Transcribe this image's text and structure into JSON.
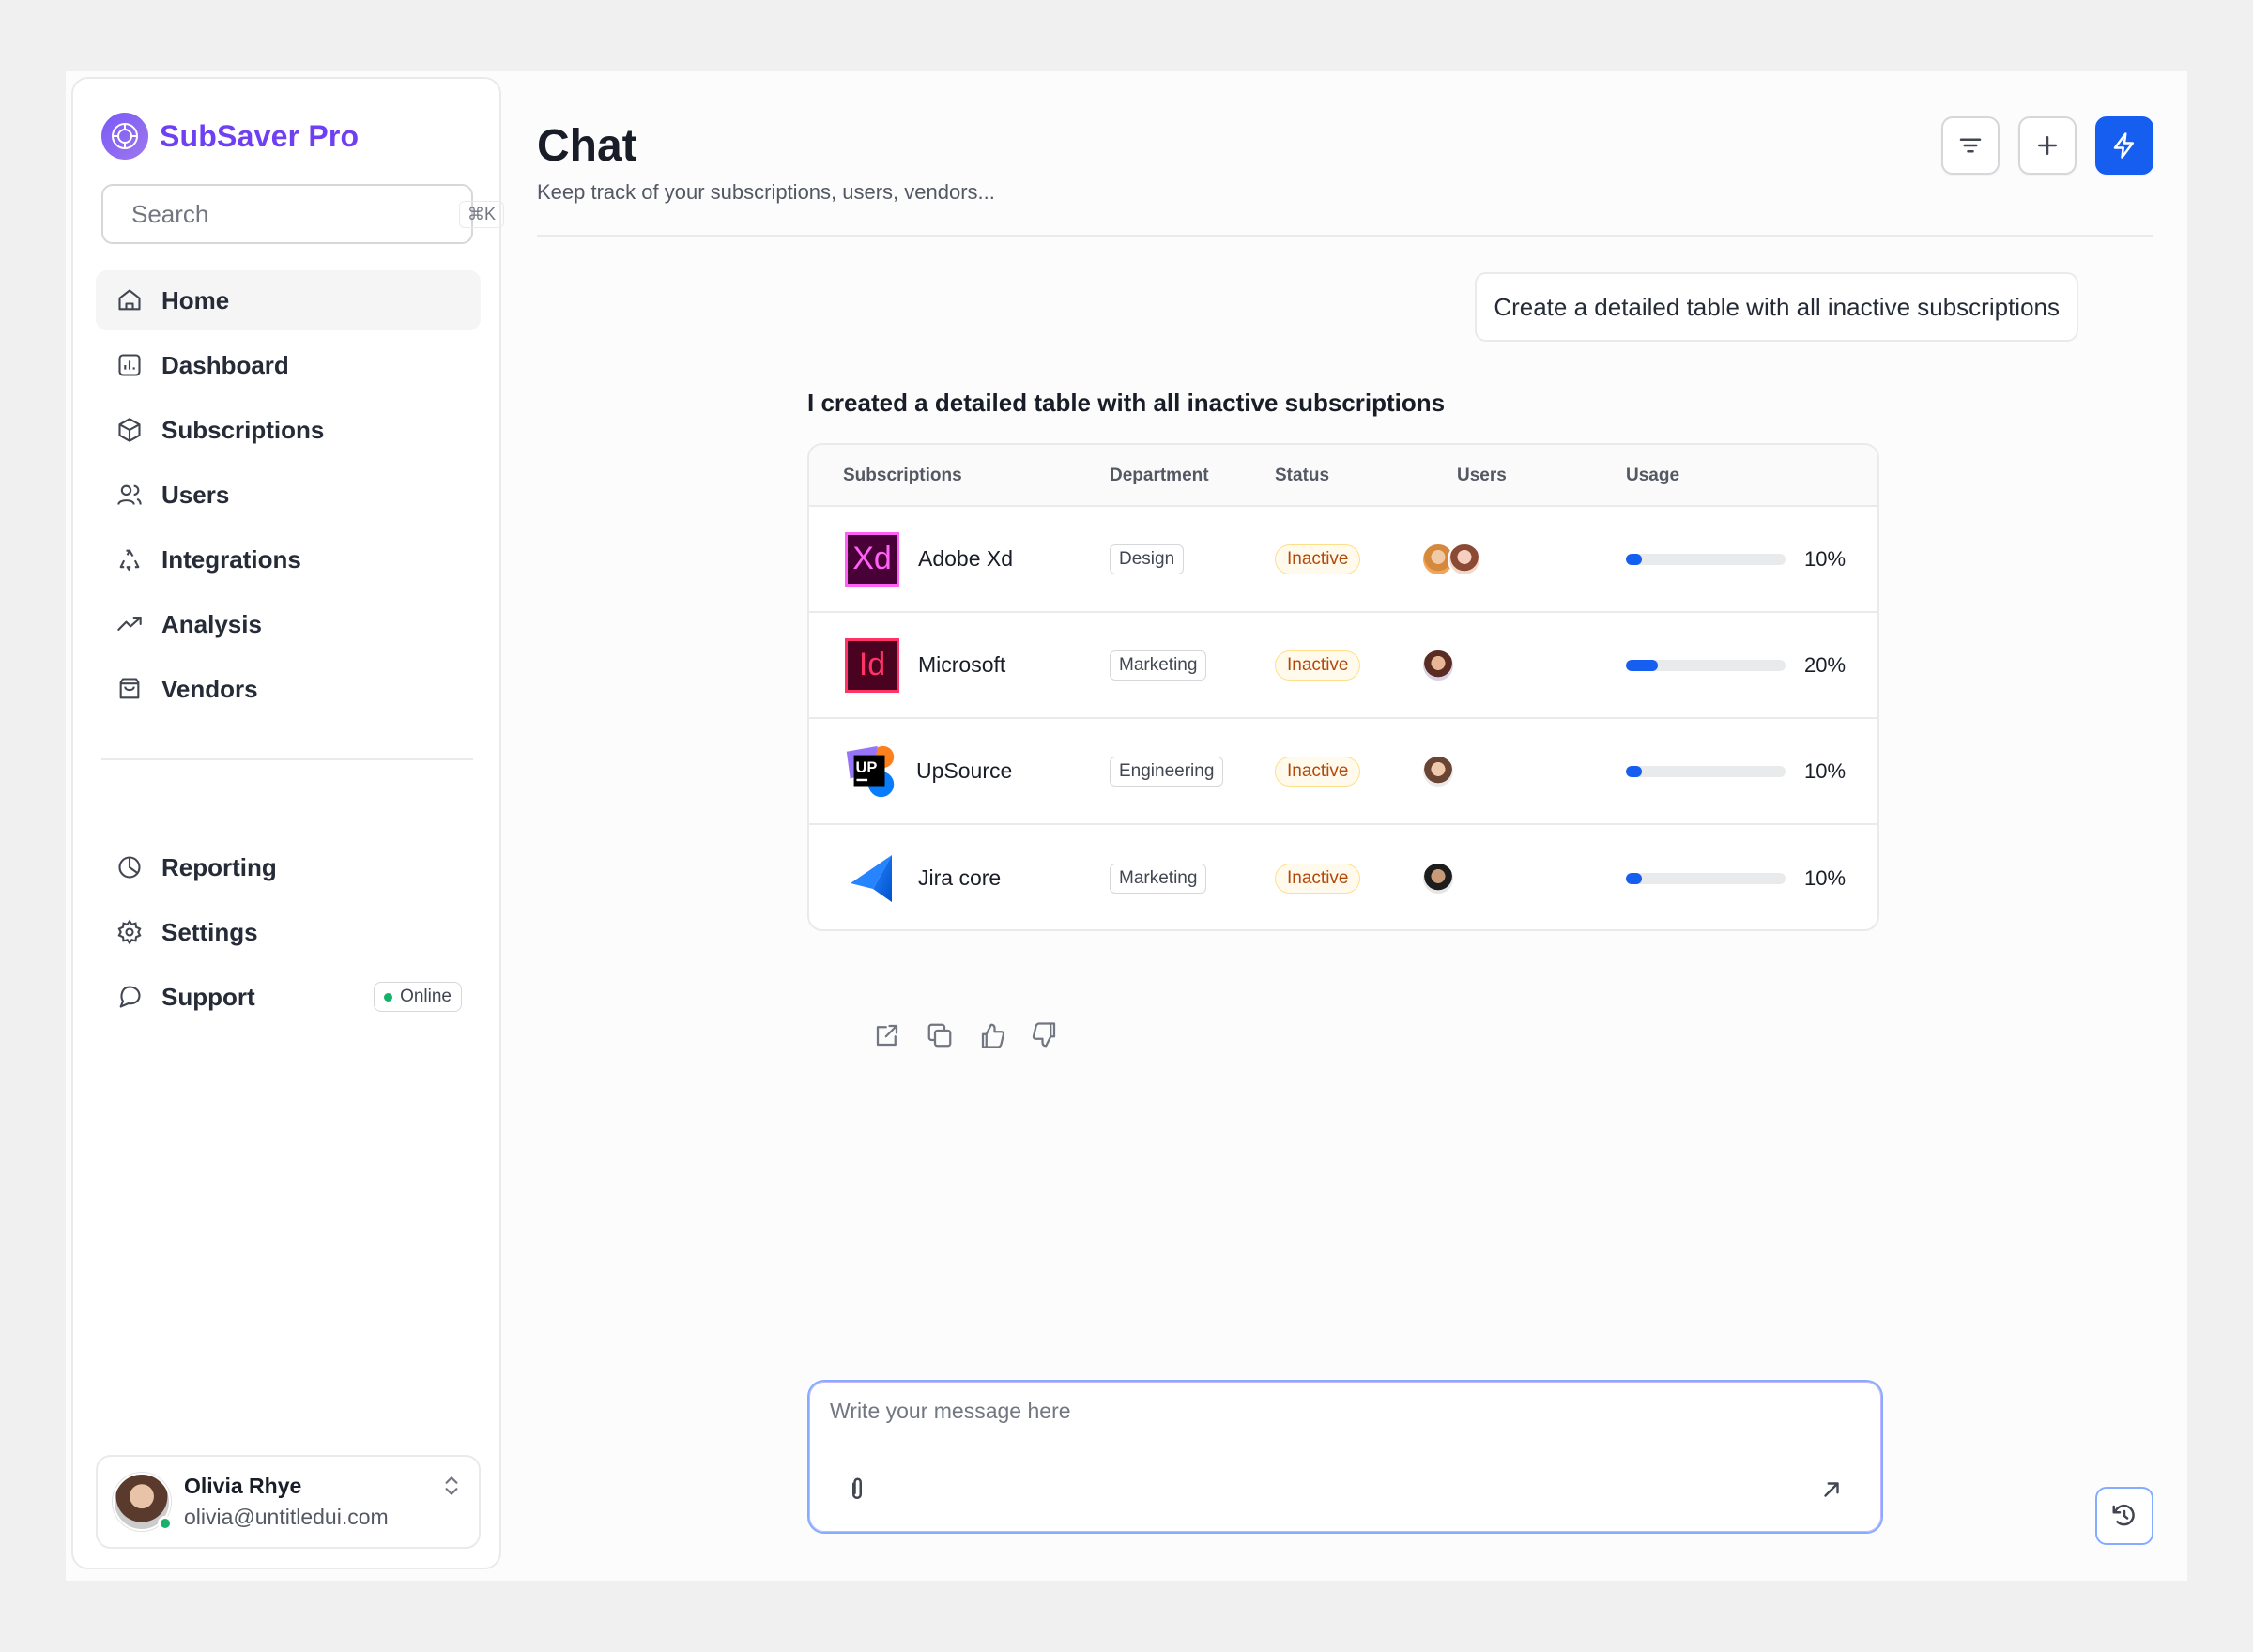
{
  "app": {
    "brand_name": "SubSaver Pro",
    "brand_icon": "logo-icon"
  },
  "search": {
    "placeholder": "Search",
    "shortcut": "⌘K"
  },
  "nav_primary": [
    {
      "label": "Home",
      "icon": "home-icon",
      "active": true
    },
    {
      "label": "Dashboard",
      "icon": "bar-chart-icon"
    },
    {
      "label": "Subscriptions",
      "icon": "cube-icon"
    },
    {
      "label": "Users",
      "icon": "users-icon"
    },
    {
      "label": "Integrations",
      "icon": "recycle-icon"
    },
    {
      "label": "Analysis",
      "icon": "trend-up-icon"
    },
    {
      "label": "Vendors",
      "icon": "shopping-bag-icon"
    }
  ],
  "nav_secondary": [
    {
      "label": "Reporting",
      "icon": "pie-chart-icon"
    },
    {
      "label": "Settings",
      "icon": "gear-icon"
    },
    {
      "label": "Support",
      "icon": "message-icon",
      "badge": "Online"
    }
  ],
  "account": {
    "name": "Olivia Rhye",
    "email": "olivia@untitledui.com"
  },
  "header": {
    "title": "Chat",
    "subtitle": "Keep track of your subscriptions, users, vendors..."
  },
  "chat": {
    "user_message": "Create a detailed table with all inactive subscriptions",
    "bot_title": "I created a detailed table with all inactive subscriptions",
    "table": {
      "columns": [
        "Subscriptions",
        "Department",
        "Status",
        "Users",
        "Usage"
      ],
      "rows": [
        {
          "name": "Adobe Xd",
          "logo": "Xd",
          "department": "Design",
          "status": "Inactive",
          "usage": 10,
          "usage_label": "10%"
        },
        {
          "name": "Microsoft",
          "logo": "Id",
          "department": "Marketing",
          "status": "Inactive",
          "usage": 20,
          "usage_label": "20%"
        },
        {
          "name": "UpSource",
          "logo": "UP",
          "department": "Engineering",
          "status": "Inactive",
          "usage": 10,
          "usage_label": "10%"
        },
        {
          "name": "Jira core",
          "logo": "jira",
          "department": "Marketing",
          "status": "Inactive",
          "usage": 10,
          "usage_label": "10%"
        }
      ]
    }
  },
  "composer": {
    "placeholder": "Write your message here"
  },
  "colors": {
    "accent": "#155eef",
    "brand": "#6e3ff3",
    "status_inactive": "#b54708",
    "online": "#17b26a"
  }
}
